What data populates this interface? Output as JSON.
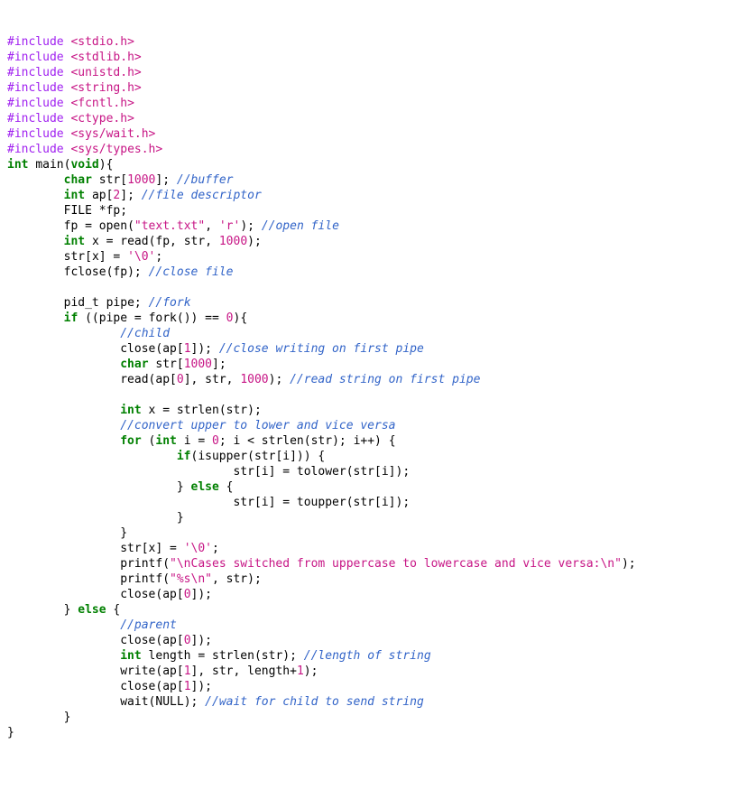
{
  "colors": {
    "preprocessor": "#a020f0",
    "string": "#c71585",
    "keyword": "#008000",
    "number": "#c71585",
    "comment": "#3264c8",
    "identifier": "#000000",
    "background": "#ffffff"
  },
  "code": {
    "includes": [
      {
        "directive": "#include",
        "header": "<stdio.h>"
      },
      {
        "directive": "#include",
        "header": "<stdlib.h>"
      },
      {
        "directive": "#include",
        "header": "<unistd.h>"
      },
      {
        "directive": "#include",
        "header": "<string.h>"
      },
      {
        "directive": "#include",
        "header": "<fcntl.h>"
      },
      {
        "directive": "#include",
        "header": "<ctype.h>"
      },
      {
        "directive": "#include",
        "header": "<sys/wait.h>"
      },
      {
        "directive": "#include",
        "header": "<sys/types.h>"
      }
    ],
    "tokens": {
      "kw_int": "int",
      "kw_char": "char",
      "kw_void": "void",
      "kw_if": "if",
      "kw_else": "else",
      "kw_for": "for",
      "fn_main": "main",
      "id_str": "str",
      "id_ap": "ap",
      "id_fp": "fp",
      "id_FILE": "FILE",
      "id_open": "open",
      "id_read": "read",
      "id_fclose": "fclose",
      "id_close": "close",
      "id_fork": "fork",
      "id_strlen": "strlen",
      "id_isupper": "isupper",
      "id_tolower": "tolower",
      "id_toupper": "toupper",
      "id_printf": "printf",
      "id_write": "write",
      "id_wait": "wait",
      "id_NULL": "NULL",
      "id_pid_t": "pid_t",
      "id_pipe": "pipe",
      "id_x": "x",
      "id_i": "i",
      "id_length": "length",
      "num_1000": "1000",
      "num_2": "2",
      "num_0": "0",
      "num_1": "1",
      "str_text": "\"text.txt\"",
      "chr_r": "'r'",
      "chr_nul": "'\\0'",
      "str_cases": "\"\\nCases switched from uppercase to lowercase and vice versa:\\n\"",
      "str_fmt": "\"%s\\n\"",
      "cmt_buffer": "//buffer",
      "cmt_fd": "//file descriptor",
      "cmt_openfile": "//open file",
      "cmt_closefile": "//close file",
      "cmt_fork": "//fork",
      "cmt_child": "//child",
      "cmt_close_write": "//close writing on first pipe",
      "cmt_read_pipe": "//read string on first pipe",
      "cmt_convert": "//convert upper to lower and vice versa",
      "cmt_parent": "//parent",
      "cmt_len": "//length of string",
      "cmt_wait": "//wait for child to send string"
    }
  }
}
